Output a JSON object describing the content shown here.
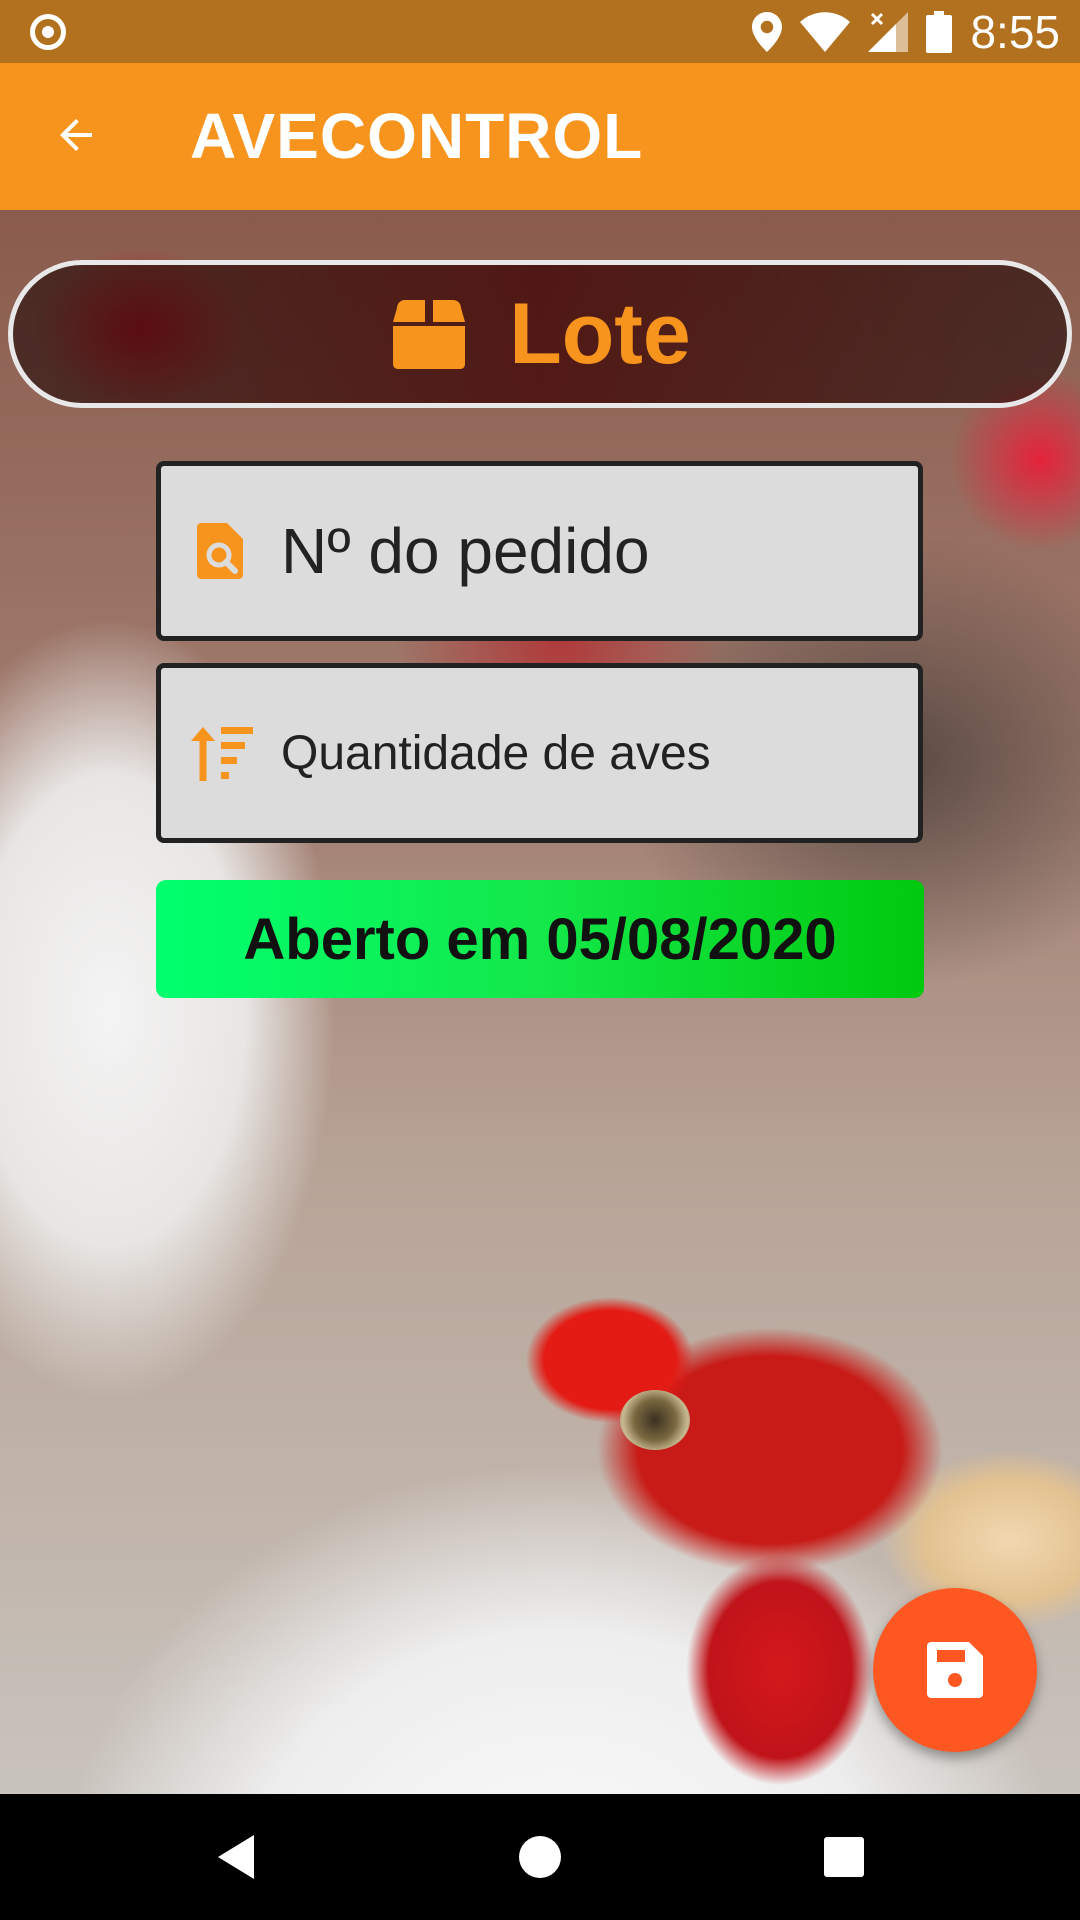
{
  "status_bar": {
    "time": "8:55",
    "icons": [
      "record-icon",
      "location-icon",
      "wifi-icon",
      "signal-icon",
      "battery-icon"
    ]
  },
  "app_bar": {
    "title": "AVECONTROL",
    "back_icon": "arrow-left-icon"
  },
  "header": {
    "title": "Lote",
    "icon": "box-icon"
  },
  "form": {
    "order_number": {
      "placeholder": "Nº do pedido",
      "value": "",
      "icon": "file-search-icon"
    },
    "bird_quantity": {
      "placeholder": "Quantidade de aves",
      "value": "",
      "icon": "sort-amount-up-icon"
    }
  },
  "status": {
    "opened_label": "Aberto em 05/08/2020"
  },
  "fab": {
    "icon": "save-icon"
  },
  "nav_bar": {
    "buttons": [
      "back-triangle-icon",
      "home-circle-icon",
      "recents-square-icon"
    ]
  },
  "colors": {
    "status_bar": "#b2711e",
    "app_bar": "#f7941d",
    "accent_orange": "#f7941d",
    "fab": "#ff5722",
    "date_pill_start": "#00ff6e",
    "date_pill_end": "#00c90e",
    "field_bg": "#dcdcdc"
  }
}
